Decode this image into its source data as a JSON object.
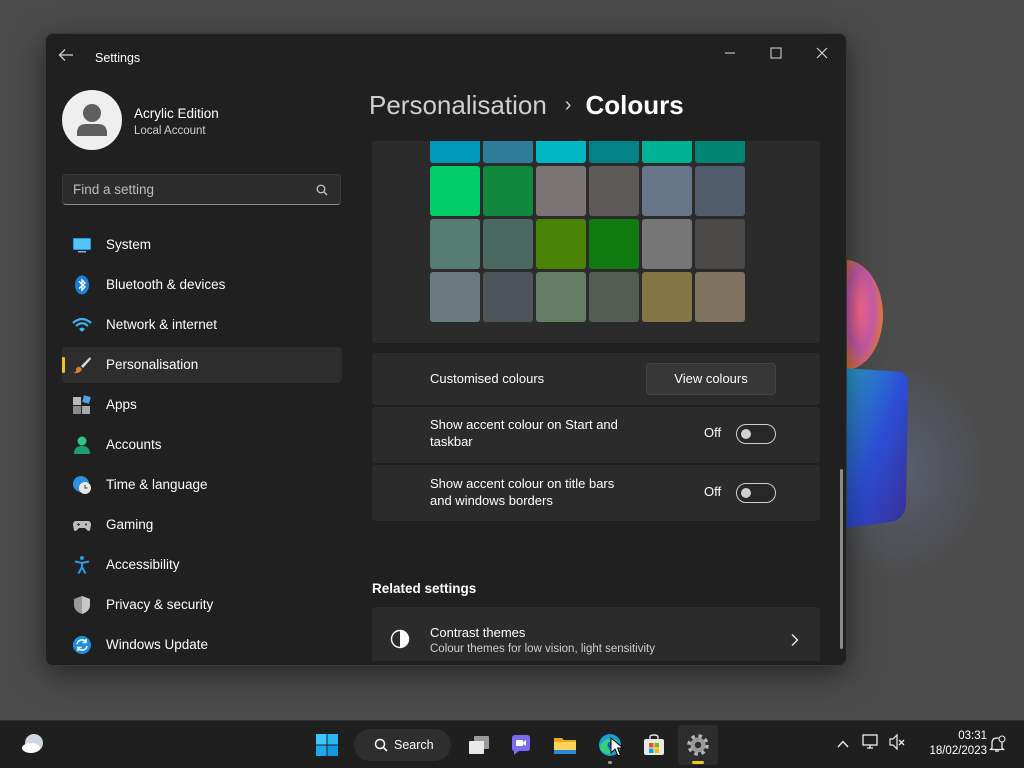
{
  "window": {
    "app_title": "Settings"
  },
  "profile": {
    "name": "Acrylic Edition",
    "account_type": "Local Account"
  },
  "search": {
    "placeholder": "Find a setting"
  },
  "nav": {
    "items": [
      {
        "label": "System",
        "icon": "monitor-icon"
      },
      {
        "label": "Bluetooth & devices",
        "icon": "bluetooth-icon"
      },
      {
        "label": "Network & internet",
        "icon": "wifi-icon"
      },
      {
        "label": "Personalisation",
        "icon": "brush-icon",
        "selected": true
      },
      {
        "label": "Apps",
        "icon": "apps-icon"
      },
      {
        "label": "Accounts",
        "icon": "person-icon"
      },
      {
        "label": "Time & language",
        "icon": "globe-clock-icon"
      },
      {
        "label": "Gaming",
        "icon": "gamepad-icon"
      },
      {
        "label": "Accessibility",
        "icon": "accessibility-icon"
      },
      {
        "label": "Privacy & security",
        "icon": "shield-icon"
      },
      {
        "label": "Windows Update",
        "icon": "update-icon"
      }
    ]
  },
  "breadcrumb": {
    "parent": "Personalisation",
    "separator": "›",
    "current": "Colours"
  },
  "swatches": [
    [
      "#0099bc",
      "#2d7d9a",
      "#00b7c3",
      "#038387",
      "#00b294",
      "#018574"
    ],
    [
      "#00cc6a",
      "#10893e",
      "#7a7574",
      "#5d5a58",
      "#68768a",
      "#515c6b"
    ],
    [
      "#567c73",
      "#486860",
      "#498205",
      "#107c10",
      "#767676",
      "#4c4a48"
    ],
    [
      "#69797e",
      "#4a5459",
      "#647c64",
      "#525e54",
      "#847545",
      "#7e735f"
    ]
  ],
  "custom_colours": {
    "label": "Customised colours",
    "button": "View colours"
  },
  "accent_start": {
    "label": "Show accent colour on Start and taskbar",
    "state": "Off"
  },
  "accent_titlebars": {
    "label": "Show accent colour on title bars and windows borders",
    "state": "Off"
  },
  "related": {
    "heading": "Related settings",
    "contrast": {
      "title": "Contrast themes",
      "subtitle": "Colour themes for low vision, light sensitivity"
    }
  },
  "taskbar": {
    "search_label": "Search",
    "apps": [
      "start-icon",
      "task-view-icon",
      "chat-icon",
      "file-explorer-icon",
      "edge-icon",
      "store-icon",
      "settings-icon"
    ],
    "clock": {
      "time": "03:31",
      "date": "18/02/2023"
    }
  },
  "accent_color": "#f5c518"
}
